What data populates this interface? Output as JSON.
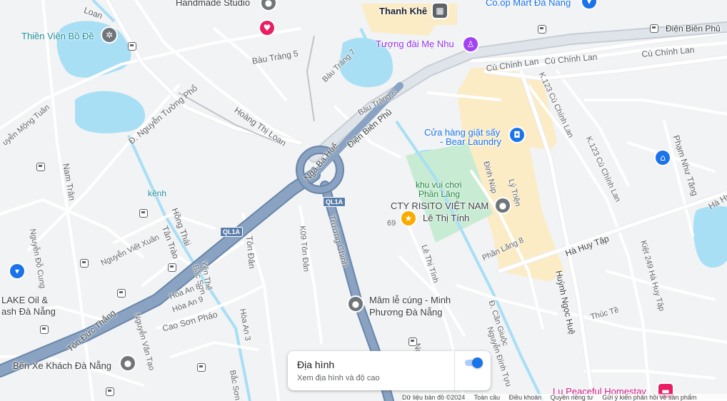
{
  "map": {
    "places": {
      "handmade_studio": "Handmade Studio",
      "thanh_khe": "Thanh Khê",
      "coop_mart": "Co.op Mart Đà Nẵng",
      "thien_vien": "Thiền Viện Bồ Đề",
      "tuong_dai": "Tượng đài Mẹ Nhu",
      "bear_laundry_1": "Cửa hàng giặt sấy",
      "bear_laundry_2": "- Bear Laundry",
      "khu_vui_choi_1": "khu vui chơi",
      "khu_vui_choi_2": "Phần Lăng",
      "cty_risito": "CTY RISITO VIỆT NAM",
      "le_thi_tinh_poi": "Lê Thị Tính",
      "mam_le_cung_1": "Mâm lễ cúng - Minh",
      "mam_le_cung_2": "Phương Đà Nẵng",
      "kenh": "kênh",
      "lake_oil_1": "LAKE Oil &",
      "lake_oil_2": "ash Đà Nẵng",
      "ben_xe": "Bến Xe Khách Đà Nẵng",
      "lu_peaceful": "Lu Peaceful Homestay",
      "number_69": "69"
    },
    "roads": {
      "loan_top": "Loan",
      "dien_bien_phu_right": "Điện Biên Phủ",
      "dien_bien_phu_center": "Điện Biên Phủ",
      "bau_trang_5": "Bàu Tràng 5",
      "bau_trang_7": "Bàu Tràng 7",
      "bau_trang_6": "Bàu Tràng 6",
      "cu_chinh_lan_1": "Cù Chính Lan",
      "cu_chinh_lan_2": "Cù Chính Lan",
      "cu_chinh_lan_3": "Cù Chính Lan",
      "k123_a": "K.123 Cù Chính Lan",
      "k123_b": "K.123 Cù Chính Lan",
      "nguyen_tuong_pho": "Đ. Nguyễn Tường Phổ",
      "hoang_thi_loan": "Hoàng Thị Loan",
      "nga_ba_hue": "Ngã Ba Huế",
      "nguyen_mong_tuan": "uyễn Mộng Tuân",
      "nam_tran": "Nam Trân",
      "ql1a_1": "QL1A",
      "ql1a_2": "QL1A",
      "truong_chinh": "Trường Chinh",
      "dinh_nup": "Đinh Núp",
      "ly_trien": "Lý Triện",
      "pham_nhu_tang": "Phạm Như Tăng",
      "ha_huy_right": "Hà Hu",
      "hong_thai": "Hồng Thái",
      "tan_trao": "Tân Trào",
      "nguyen_do_cung": "Nguyễn Đỗ Cung",
      "nguyen_viet_xuan": "Nguyễn Viết Xuân",
      "ton_dan": "Tôn Đản",
      "k09_ton_dan": "K09 Tôn Đản",
      "le_thi_tinh_road": "Lê Thị Tính",
      "phan_lang_8": "Phần Lăng 8",
      "ha_huy_tap": "Hà Huy Tập",
      "huynh_ngoc_hue": "Huỳnh Ngọc Huệ",
      "kiet_249": "Kiệt 249 Hà Huy Tập",
      "yen_the": "Yên Thế",
      "bac_son": "Bắc Sơn",
      "bac_son_2": "Bắc Sơn",
      "hoa_an_8": "Hòa An 8",
      "hoa_an_9": "Hòa An 9",
      "cao_son_phao": "Cao Sơn Pháo",
      "hoa_an_3": "Hòa An 3",
      "ton_duc_thang": "Tôn Đức Thắng",
      "nguyen_van_tao": "Nguyễn Văn Tạo",
      "thuc_te": "Thúc Tề",
      "can_giuoc": "Đ. Cần Giuộc",
      "nguyen_dinh_tuu": "Nguyễn Đình Tựu",
      "no_partial": "Ng",
      "tran_left": "Trần",
      "ni": "ni",
      "van_le": "Văn Lê"
    },
    "road_shields": [
      "QL1A",
      "QL1A"
    ]
  },
  "terrain_panel": {
    "title": "Địa hình",
    "subtitle": "Xem địa hình và độ cao",
    "toggle_on": true
  },
  "footer": {
    "map_data": "Dữ liệu bản đồ ©2024",
    "privacy": "Toàn cầu",
    "terms": "Điều khoản",
    "privacy_rights": "Quyền riêng tư",
    "feedback": "Gửi ý kiến phản hồi về sản phẩm"
  },
  "colors": {
    "water": "#a8dff5",
    "park": "#c7ecd3",
    "highway": "#7c96b8",
    "commercial": "#fbecc5",
    "accent": "#1a73e8"
  }
}
